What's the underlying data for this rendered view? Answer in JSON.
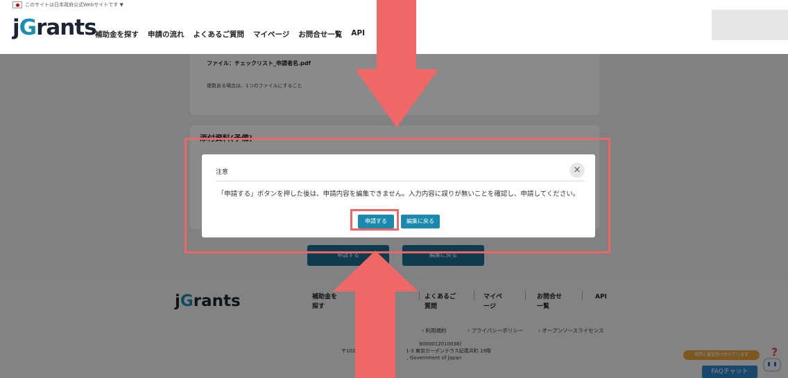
{
  "header": {
    "gov_notice": "このサイトは日本政府公式Webサイトです ▼",
    "logo_prefix": "j",
    "logo_g": "G",
    "logo_rest": "rants",
    "nav": [
      "補助金を探す",
      "申請の流れ",
      "よくあるご質問",
      "マイページ",
      "お問合せ一覧",
      "API"
    ]
  },
  "content": {
    "file_label": "ファイル：チェックリスト_申請者名.pdf",
    "file_note": "複数ある場合は、1つのファイルにすること",
    "section_title": "添付資料(予備)",
    "bg_button_1": "申請する",
    "bg_button_2": "編集に戻る"
  },
  "modal": {
    "title": "注意",
    "close": "×",
    "message": "「申請する」ボタンを押した後は、申請内容を編集できません。入力内容に誤りが無いことを確認し、申請してください。",
    "submit": "申請する",
    "back": "編集に戻る"
  },
  "footer": {
    "logo_prefix": "j",
    "logo_g": "G",
    "logo_rest": "rants",
    "nav": [
      "補助金を\n探す",
      "よくあるご\n質問",
      "マイペ\nージ",
      "お問合せ\n一覧",
      "API"
    ],
    "links": [
      "利用規約",
      "プライバシーポリシー",
      "オープンソースライセンス"
    ],
    "address_1": "デジ                         8000012010038)",
    "address_2": "〒102-0094 東京都千          1-3 東京ガーデンテラス紀尾井町 19階",
    "address_3": "© 202             , Government of Japan"
  },
  "chat": {
    "banner": "質問と要望受け付けています",
    "button": "FAQチャット"
  },
  "colors": {
    "accent": "#1b88ad",
    "highlight": "#ee6666",
    "overlay": "rgba(0,0,0,0.46)"
  }
}
